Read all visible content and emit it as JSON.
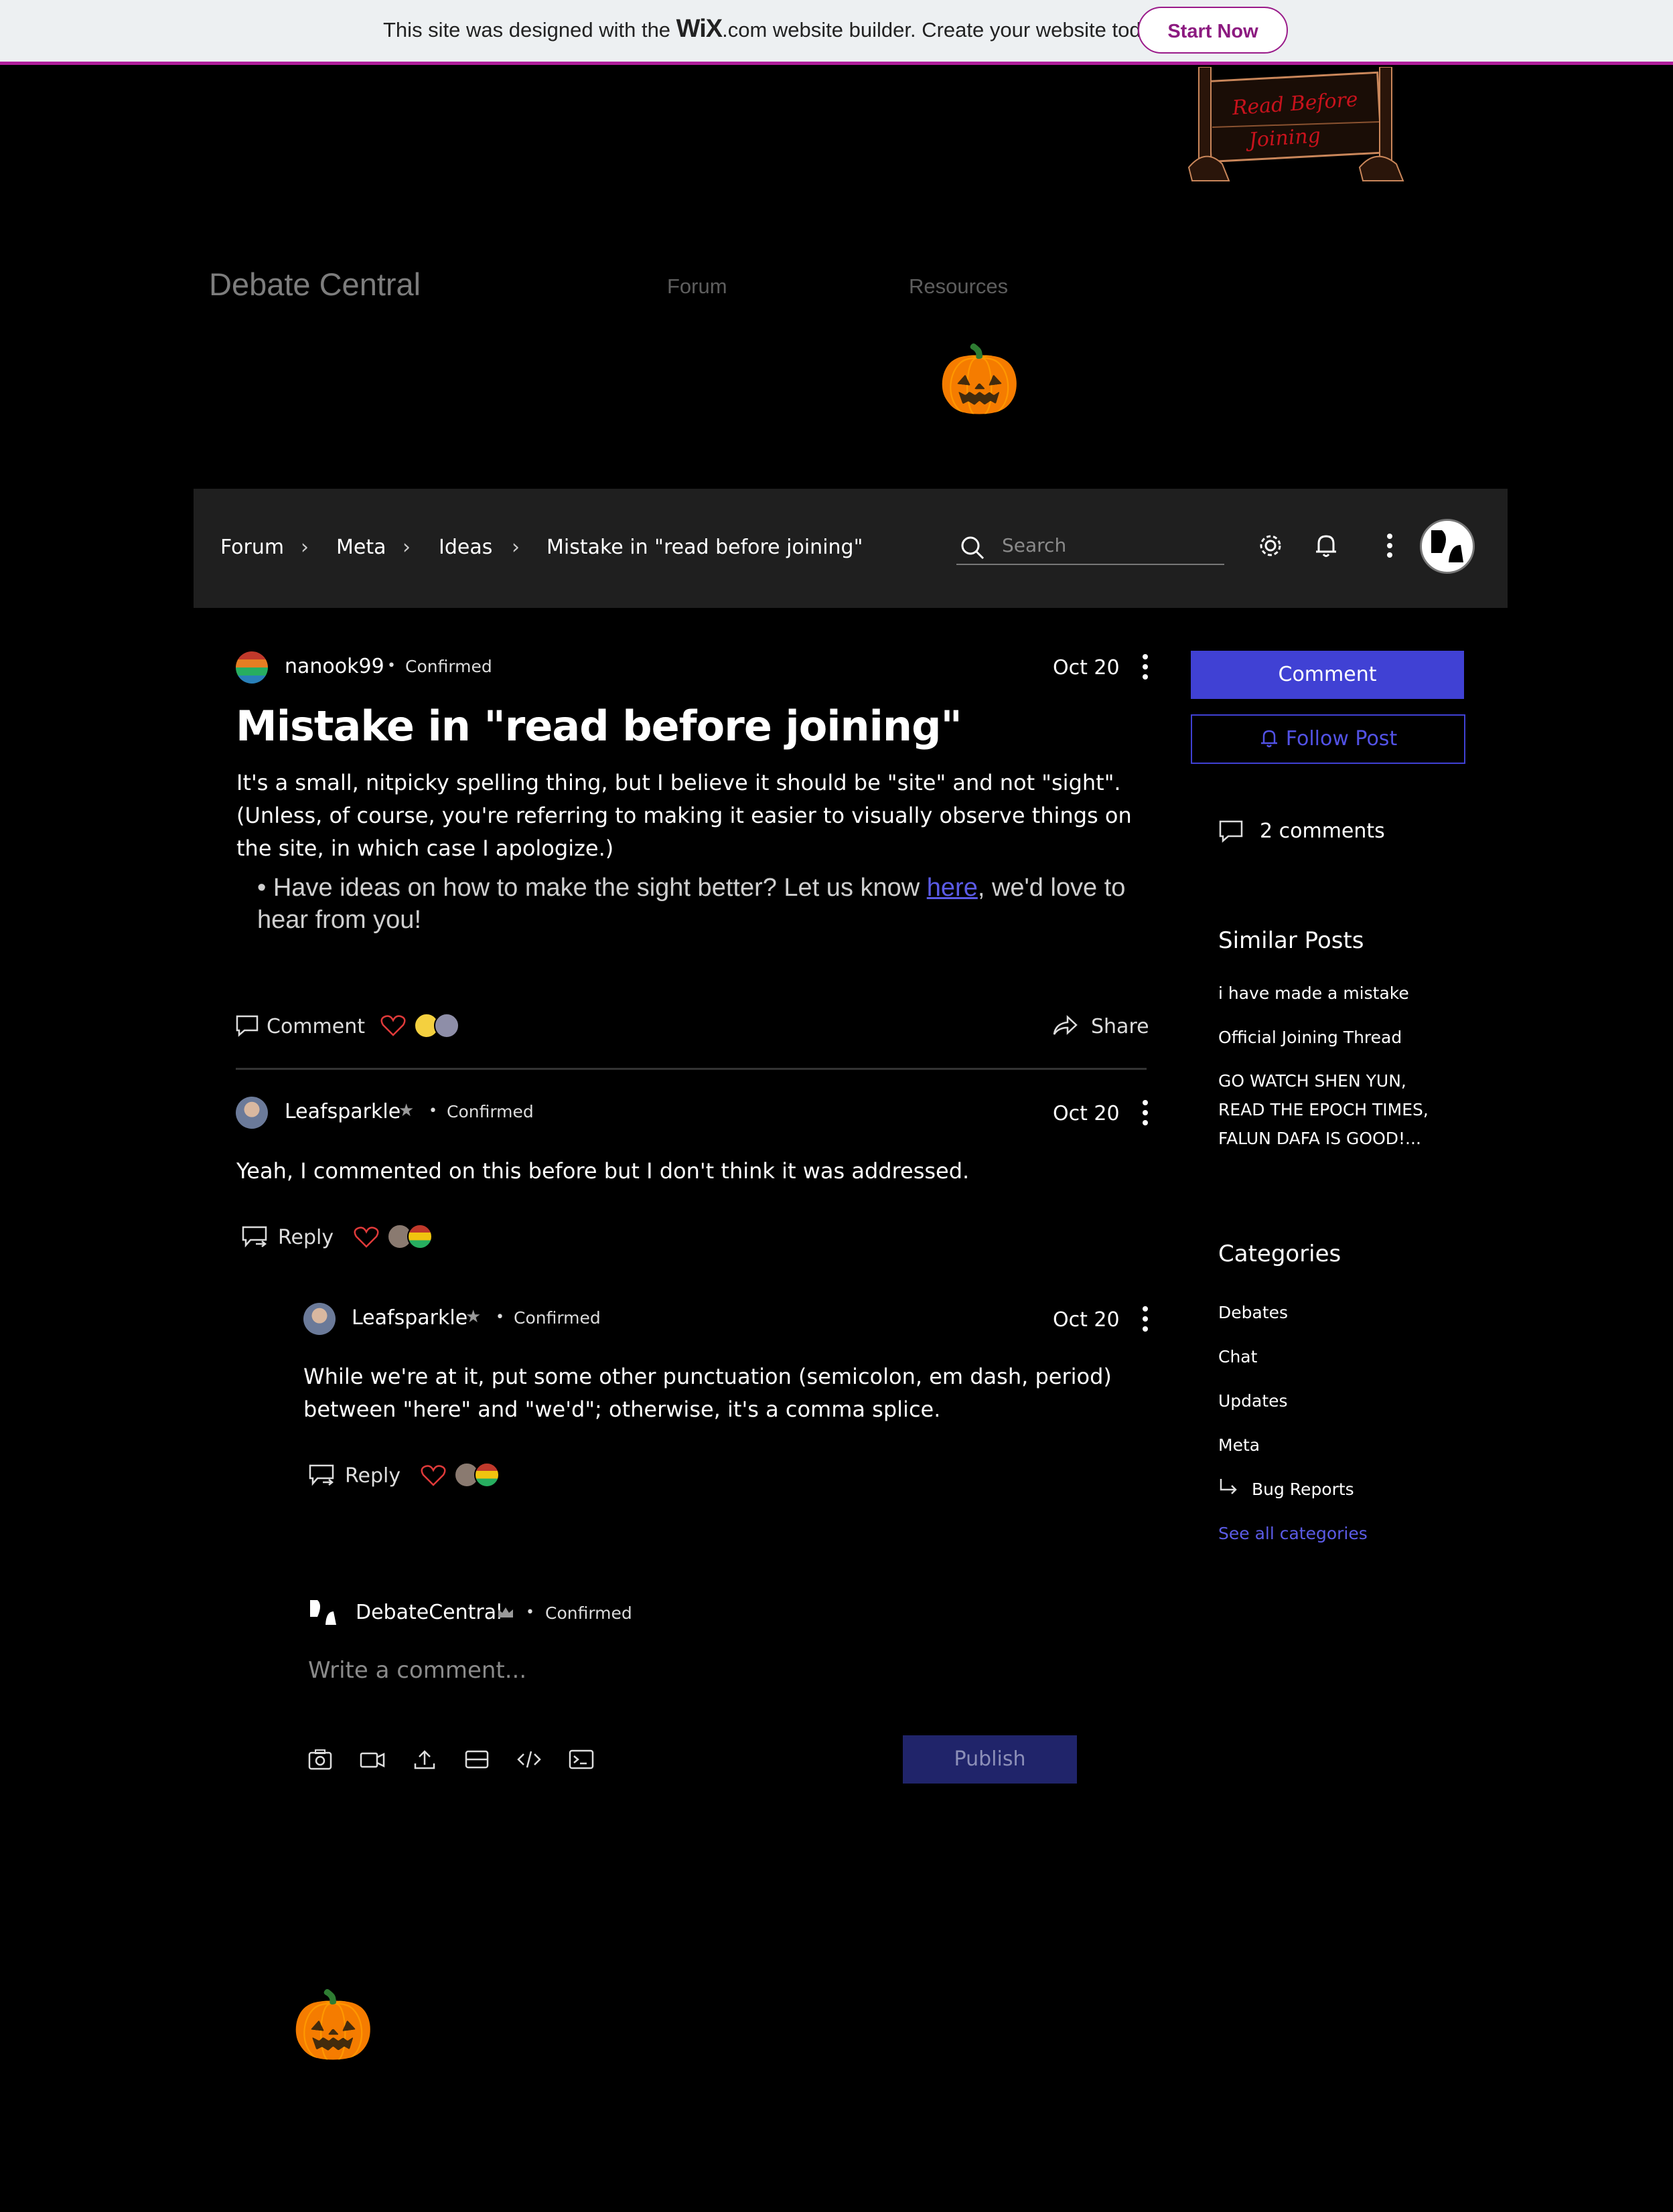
{
  "wix_banner": {
    "text_before": "This site was designed with the ",
    "brand": "WiX",
    "text_after": ".com website builder. Create your website today.",
    "cta": "Start Now"
  },
  "sign": {
    "text": "Read Before Joining"
  },
  "site": {
    "title": "Debate Central",
    "nav": [
      "Forum",
      "Resources"
    ]
  },
  "breadcrumb": [
    "Forum",
    "Meta",
    "Ideas",
    "Mistake in \"read before joining\""
  ],
  "search": {
    "placeholder": "Search"
  },
  "post": {
    "author": "nanook99",
    "badge": "Confirmed",
    "date": "Oct 20",
    "title": "Mistake in \"read before joining\"",
    "body": "It's a small, nitpicky spelling thing, but I believe it should be \"site\" and not \"sight\". (Unless, of course, you're referring to making it easier to visually observe things on the site, in which case I apologize.)",
    "bullet_before": "• Have ideas on how to make the sight better? Let us know ",
    "bullet_link": "here",
    "bullet_after": ", we'd love to hear from you!",
    "comment_label": "Comment",
    "share_label": "Share"
  },
  "comments": [
    {
      "author": "Leafsparkle",
      "badge": "Confirmed",
      "date": "Oct 20",
      "text": "Yeah, I commented on this before but I don't think it was addressed.",
      "reply_label": "Reply"
    },
    {
      "author": "Leafsparkle",
      "badge": "Confirmed",
      "date": "Oct 20",
      "text": "While we're at it, put some other punctuation (semicolon, em dash, period) between \"here\" and \"we'd\"; otherwise, it's a comma splice.",
      "reply_label": "Reply"
    }
  ],
  "composer": {
    "author": "DebateCentral",
    "badge": "Confirmed",
    "placeholder": "Write a comment...",
    "publish": "Publish"
  },
  "sidebar": {
    "comment_button": "Comment",
    "follow_button": "Follow Post",
    "comments_count": "2 comments",
    "similar_title": "Similar Posts",
    "similar": [
      "i have made a mistake",
      "Official Joining Thread",
      "GO WATCH SHEN YUN,",
      "READ THE EPOCH TIMES,",
      "FALUN DAFA IS GOOD!..."
    ],
    "categories_title": "Categories",
    "categories": [
      "Debates",
      "Chat",
      "Updates",
      "Meta",
      "Bug Reports"
    ],
    "see_all": "See all categories"
  },
  "colors": {
    "accent": "#4041d4",
    "banner_border": "#b01e9c",
    "heart": "#e03a3a"
  }
}
